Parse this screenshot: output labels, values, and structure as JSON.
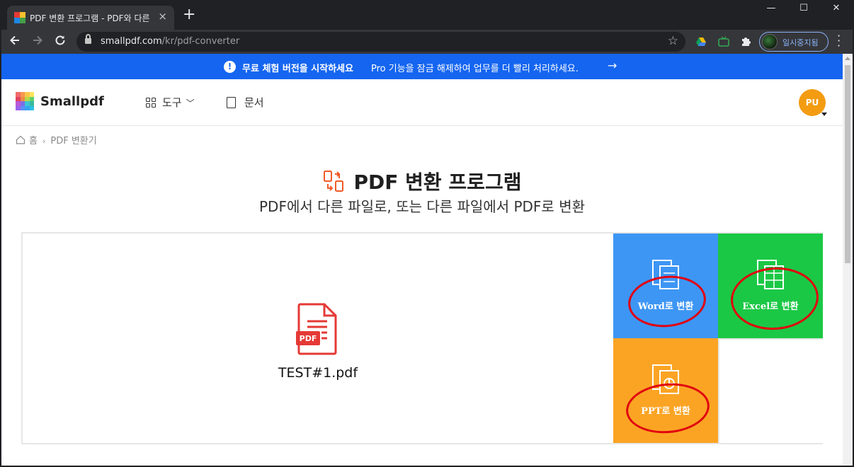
{
  "browser": {
    "tab_title": "PDF 변환 프로그램 - PDF와 다른",
    "tab_close": "×",
    "new_tab": "+",
    "url_host": "smallpdf.com",
    "url_path": "/kr/pdf-converter",
    "profile_status": "일시중지됨",
    "window": {
      "minimize": "—",
      "maximize": "☐",
      "close": "✕"
    }
  },
  "banner": {
    "bold": "무료 체험 버전을 시작하세요",
    "text": "Pro 기능을 잠금 해제하여 업무를 더 빨리 처리하세요.",
    "arrow": "→",
    "info": "!"
  },
  "header": {
    "brand": "Smallpdf",
    "tools_label": "도구",
    "docs_label": "문서",
    "avatar_initials": "PU"
  },
  "breadcrumb": {
    "home": "홈",
    "separator": "›",
    "current": "PDF 변환기"
  },
  "main": {
    "title": "PDF 변환 프로그램",
    "subtitle": "PDF에서 다른 파일로, 또는 다른 파일에서 PDF로 변환",
    "file_name": "TEST#1.pdf",
    "file_badge": "PDF"
  },
  "options": {
    "word": "Word로 변환",
    "excel": "Excel로 변환",
    "ppt": "PPT로 변환"
  },
  "colors": {
    "banner": "#1565f0",
    "word": "#3d96f4",
    "excel": "#1bc845",
    "ppt": "#fba424",
    "annotation": "#e1000f",
    "pdf_red": "#e53935"
  }
}
